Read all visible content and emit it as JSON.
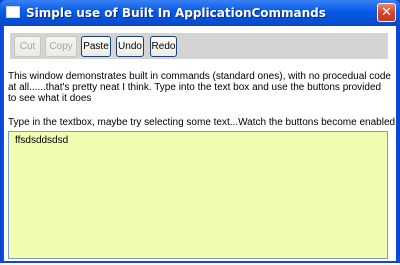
{
  "window": {
    "title": "Simple use of Built In ApplicationCommands",
    "close_glyph": "✕"
  },
  "toolbar": {
    "buttons": [
      {
        "label": "Cut",
        "enabled": false
      },
      {
        "label": "Copy",
        "enabled": false
      },
      {
        "label": "Paste",
        "enabled": true
      },
      {
        "label": "Undo",
        "enabled": true
      },
      {
        "label": "Redo",
        "enabled": true
      }
    ]
  },
  "content": {
    "description": "This window demonstrates built in commands (standard ones), with no procedual code at all......that's pretty neat I think. Type into the text box and use the buttons provided to see what it does",
    "hint": "Type in the textbox, maybe try selecting some text...Watch the buttons become enabled",
    "textbox_value": "ffsdsddsdsd"
  },
  "colors": {
    "titlebar": "#0a5de8",
    "textbox_background": "#f1fcb0",
    "toolbar_background": "#d4d4d4",
    "close_button": "#d2462b"
  },
  "icons": {
    "window_icon": "window-icon",
    "close": "close-icon"
  }
}
